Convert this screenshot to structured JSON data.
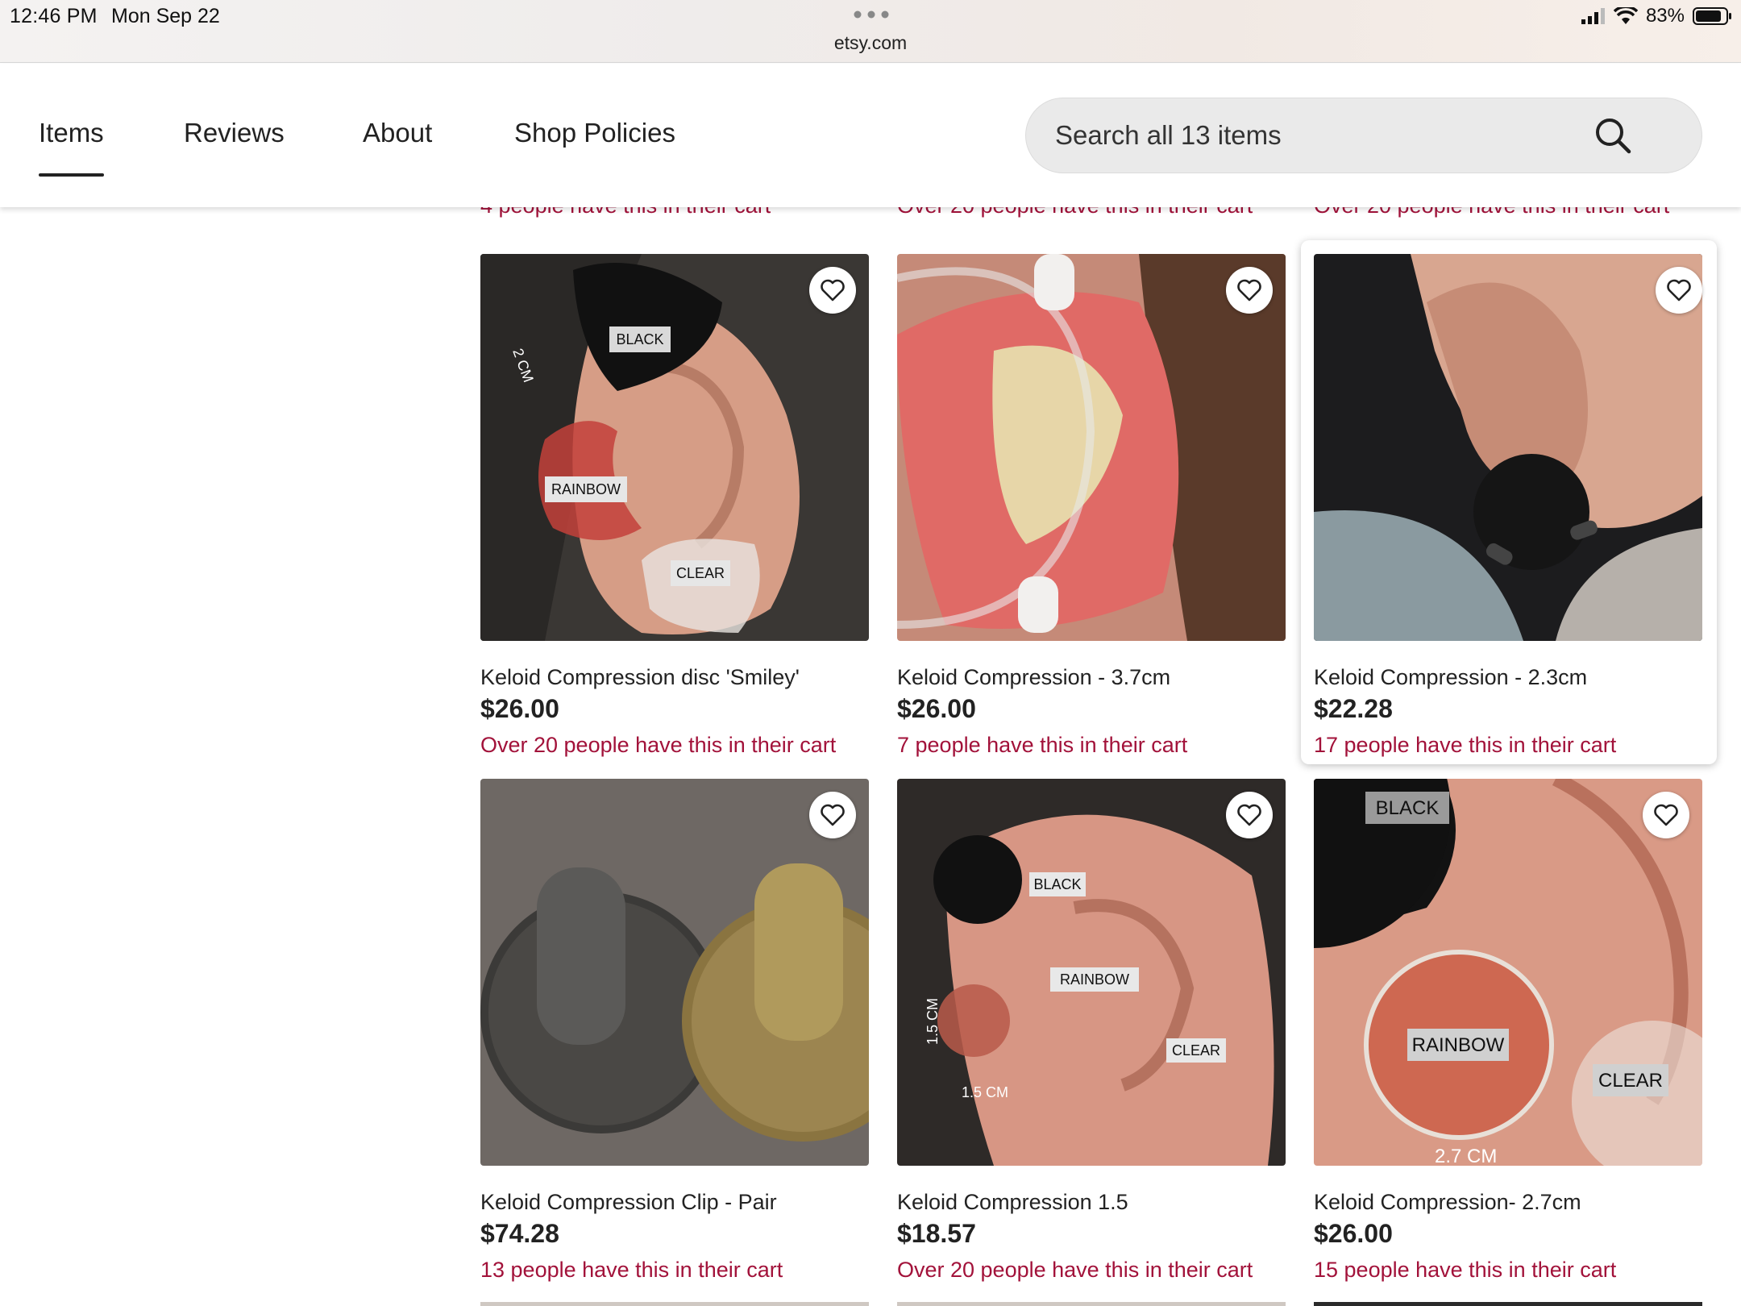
{
  "status_bar": {
    "time": "12:46 PM",
    "date": "Mon Sep 22",
    "url": "etsy.com",
    "battery": "83%"
  },
  "shop_nav": {
    "tabs": [
      {
        "label": "Items",
        "active": true
      },
      {
        "label": "Reviews",
        "active": false
      },
      {
        "label": "About",
        "active": false
      },
      {
        "label": "Shop Policies",
        "active": false
      }
    ],
    "search_placeholder": "Search all 13 items"
  },
  "previous_row_notes": [
    "4 people have this in their cart",
    "Over 20 people have this in their cart",
    "Over 20 people have this in their cart"
  ],
  "listings": [
    {
      "title": "Keloid Compression disc 'Smiley'",
      "price": "$26.00",
      "cart_note": "Over 20 people have this in their cart",
      "image_labels": [
        "BLACK",
        "RAINBOW",
        "CLEAR",
        "2 CM"
      ]
    },
    {
      "title": "Keloid Compression - 3.7cm",
      "price": "$26.00",
      "cart_note": "7 people have this in their cart",
      "image_labels": []
    },
    {
      "title": "Keloid Compression - 2.3cm",
      "price": "$22.28",
      "cart_note": "17 people have this in their cart",
      "image_labels": []
    },
    {
      "title": "Keloid Compression Clip - Pair",
      "price": "$74.28",
      "cart_note": "13 people have this in their cart",
      "image_labels": []
    },
    {
      "title": "Keloid Compression 1.5",
      "price": "$18.57",
      "cart_note": "Over 20 people have this in their cart",
      "image_labels": [
        "BLACK",
        "RAINBOW",
        "CLEAR",
        "1.5 CM",
        "1.5 CM"
      ]
    },
    {
      "title": "Keloid Compression- 2.7cm",
      "price": "$26.00",
      "cart_note": "15 people have this in their cart",
      "image_labels": [
        "BLACK",
        "RAINBOW",
        "CLEAR",
        "2.7 CM"
      ]
    }
  ],
  "icons": {
    "favorite": "heart-outline-icon",
    "search": "magnifier-icon"
  },
  "colors": {
    "cart_note": "#a2123a",
    "text": "#222222",
    "search_bg": "#eaeaea"
  }
}
